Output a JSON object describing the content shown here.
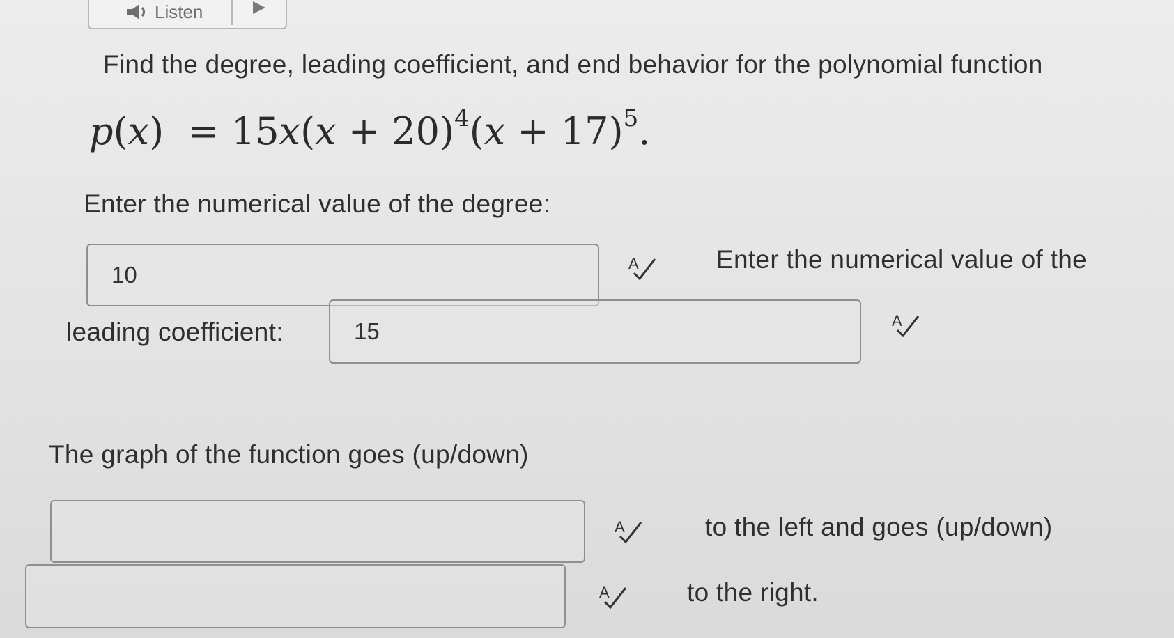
{
  "listen": {
    "label": "Listen"
  },
  "question": {
    "intro": "Find the degree, leading coefficient, and end behavior for the polynomial function",
    "formula": {
      "lhs": "p(x)",
      "coef": "15",
      "factor1": "(x + 20)",
      "exp1": "4",
      "factor2": "(x + 17)",
      "exp2": "5",
      "end": "."
    }
  },
  "degree": {
    "prompt": "Enter the numerical value of the degree:",
    "value": "10"
  },
  "leading_coefficient": {
    "prompt_part1": "Enter the numerical value of the",
    "prompt_part2": "leading coefficient:",
    "value": "15"
  },
  "end_behavior": {
    "prompt": "The graph of the function goes (up/down)",
    "left_value": "",
    "middle_text": "to the left and goes (up/down)",
    "right_value": "",
    "end_text": "to the right."
  },
  "icons": {
    "speaker": "speaker-icon",
    "play": "play-icon",
    "spellcheck": "spellcheck-icon"
  }
}
